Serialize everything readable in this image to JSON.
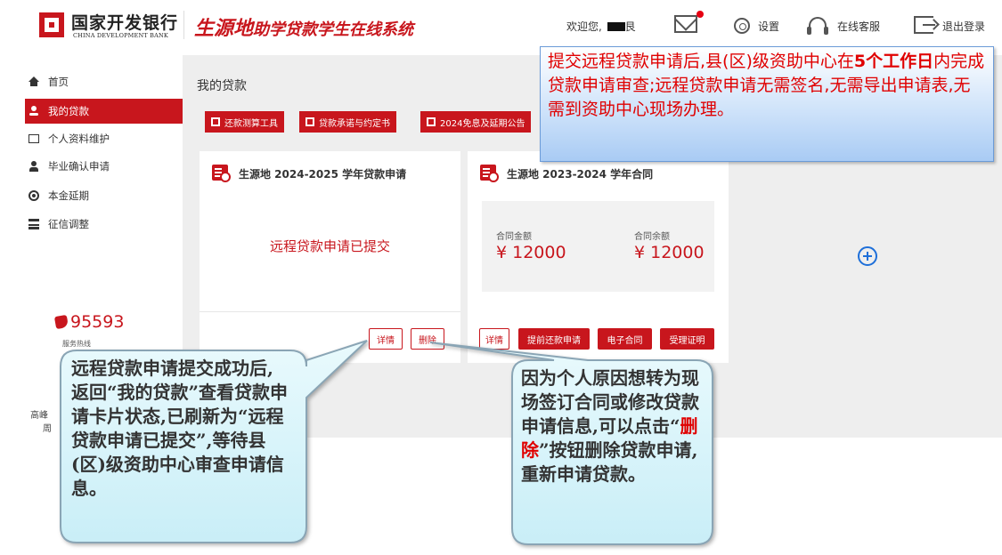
{
  "header": {
    "bank_cn": "国家开发银行",
    "bank_en": "CHINA DEVELOPMENT BANK",
    "system_title_main": "生源地",
    "system_title_sub": "助学贷款学生在线系统",
    "welcome": "欢迎您,",
    "welcome_suffix": "艮",
    "settings": "设置",
    "service": "在线客服",
    "logout": "退出登录"
  },
  "sidebar": {
    "items": [
      {
        "label": "首页",
        "icon": "home-icon"
      },
      {
        "label": "我的贷款",
        "icon": "user-icon",
        "active": true
      },
      {
        "label": "个人资料维护",
        "icon": "id-card-icon"
      },
      {
        "label": "毕业确认申请",
        "icon": "person-icon"
      },
      {
        "label": "本金延期",
        "icon": "clock-icon"
      },
      {
        "label": "征信调整",
        "icon": "bank-icon"
      }
    ],
    "hotline": "95593",
    "hotline_sub": "服务热线",
    "footer_a": "高峰",
    "footer_b": "周"
  },
  "main": {
    "page_title": "我的贷款",
    "toolbar": [
      {
        "label": "还款测算工具"
      },
      {
        "label": "贷款承诺与约定书"
      },
      {
        "label": "2024免息及延期公告"
      }
    ],
    "card1": {
      "title": "生源地 2024-2025 学年贷款申请",
      "status": "远程贷款申请已提交",
      "btn_detail": "详情",
      "btn_delete": "删除"
    },
    "card2": {
      "title": "生源地 2023-2024 学年合同",
      "amount_label": "合同金额",
      "amount_value": "¥ 12000",
      "balance_label": "合同余额",
      "balance_value": "¥ 12000",
      "btn_detail": "详情",
      "btn_prepay": "提前还款申请",
      "btn_contract": "电子合同",
      "btn_certificate": "受理证明"
    }
  },
  "annotations": {
    "top_note_a": "提交远程贷款申请后,县(区)级资助中心在",
    "top_note_bold": "5个工作日",
    "top_note_b": "内完成贷款申请审查;远程贷款申请无需签名,无需导出申请表,无需到资助中心现场办理。",
    "left_bubble": "远程贷款申请提交成功后,返回“我的贷款”查看贷款申请卡片状态,已刷新为“远程贷款申请已提交”,等待县(区)级资助中心审查申请信息。",
    "right_bubble_a": "因为个人原因想转为现场签订合同或修改贷款申请信息,可以点击“",
    "right_bubble_red": "删除",
    "right_bubble_b": "”按钮删除贷款申请,重新申请贷款。"
  },
  "colors": {
    "brand_red": "#c8161d",
    "note_red": "#e00000",
    "add_blue": "#1e6fd9"
  }
}
